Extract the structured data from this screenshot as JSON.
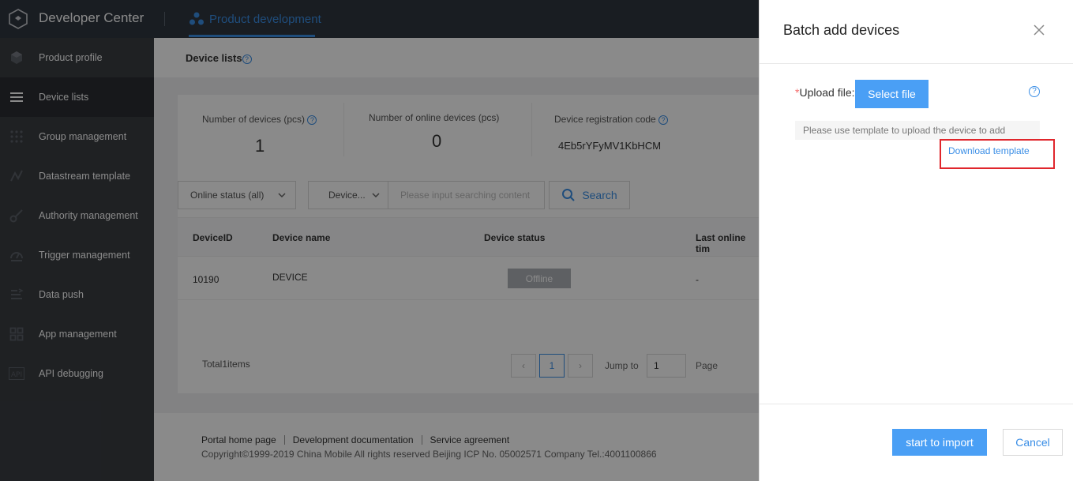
{
  "topbar": {
    "app_title": "Developer Center",
    "tab_label": "Product development"
  },
  "sidebar": {
    "items": [
      {
        "label": "Product profile",
        "icon": "cube-icon"
      },
      {
        "label": "Device lists",
        "icon": "list-icon",
        "active": true
      },
      {
        "label": "Group management",
        "icon": "grid-dots-icon"
      },
      {
        "label": "Datastream template",
        "icon": "graph-icon"
      },
      {
        "label": "Authority management",
        "icon": "key-icon"
      },
      {
        "label": "Trigger management",
        "icon": "gauge-icon"
      },
      {
        "label": "Data push",
        "icon": "push-icon"
      },
      {
        "label": "App management",
        "icon": "apps-icon"
      },
      {
        "label": "API debugging",
        "icon": "api-icon"
      }
    ]
  },
  "main": {
    "page_title": "Device lists",
    "stats": {
      "devices_label": "Number of devices (pcs)",
      "devices_value": "1",
      "online_label": "Number of online devices (pcs)",
      "online_value": "0",
      "code_label": "Device registration code",
      "code_value": "4Eb5rYFyMV1KbHCM"
    },
    "filters": {
      "status_select": "Online status (all)",
      "field_select": "Device...",
      "search_placeholder": "Please input searching content",
      "search_button": "Search"
    },
    "table": {
      "headers": [
        "DeviceID",
        "Device name",
        "Device status",
        "Last online tim"
      ],
      "rows": [
        {
          "device_id": "10190",
          "device_name": "DEVICE",
          "status": "Offline",
          "last_online": "-"
        }
      ]
    },
    "pagination": {
      "total": "Total1items",
      "current_page": "1",
      "prev": "‹",
      "next": "›",
      "jump_to": "Jump to",
      "jump_value": "1",
      "page": "Page"
    }
  },
  "footer": {
    "links": [
      "Portal home page",
      "Development documentation",
      "Service agreement"
    ],
    "copyright": "Copyright©1999-2019 China Mobile All rights reserved Beijing ICP No. 05002571 Company Tel.:4001100866"
  },
  "drawer": {
    "title": "Batch add devices",
    "required_mark": "*",
    "upload_label": "Upload file:",
    "select_file": "Select file",
    "hint": "Please use template to upload the device to add",
    "download_template": "Download template",
    "import_button": "start to import",
    "cancel_button": "Cancel"
  },
  "colors": {
    "accent": "#3a8ee6",
    "primary_button": "#4a9ff5",
    "topbar": "#2f3640",
    "sidebar": "#3a3d42",
    "highlight_box": "#e0262c"
  }
}
